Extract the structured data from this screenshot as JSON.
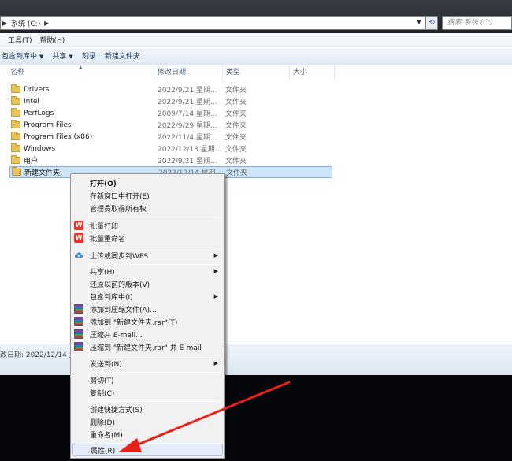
{
  "address_bar": {
    "crumbs": [
      "系统 (C:)"
    ],
    "search_placeholder": "搜索 系统 (C:)"
  },
  "menubar": {
    "items": [
      "工具(T)",
      "帮助(H)"
    ]
  },
  "toolbar": {
    "items": [
      "包含到库中",
      "共享",
      "刻录",
      "新建文件夹"
    ]
  },
  "columns": [
    "名称",
    "修改日期",
    "类型",
    "大小"
  ],
  "files": [
    {
      "name": "Drivers",
      "date": "2022/9/21 星期...",
      "type": "文件夹"
    },
    {
      "name": "Intel",
      "date": "2022/9/21 星期...",
      "type": "文件夹"
    },
    {
      "name": "PerfLogs",
      "date": "2009/7/14 星期...",
      "type": "文件夹"
    },
    {
      "name": "Program Files",
      "date": "2022/9/29 星期...",
      "type": "文件夹"
    },
    {
      "name": "Program Files (x86)",
      "date": "2022/11/4 星期...",
      "type": "文件夹"
    },
    {
      "name": "Windows",
      "date": "2022/12/13 星期...",
      "type": "文件夹"
    },
    {
      "name": "用户",
      "date": "2022/9/21 星期...",
      "type": "文件夹"
    },
    {
      "name": "新建文件夹",
      "date": "2022/12/14 星期...",
      "type": "文件夹"
    }
  ],
  "statusbar": {
    "text": "改日期: 2022/12/14 星"
  },
  "context_menu": {
    "items": [
      {
        "label": "打开(O)"
      },
      {
        "label": "在新窗口中打开(E)"
      },
      {
        "label": "管理员取得所有权"
      },
      {
        "label": "批量打印"
      },
      {
        "label": "批量重命名"
      },
      {
        "label": "上传或同步到WPS"
      },
      {
        "label": "共享(H)"
      },
      {
        "label": "还原以前的版本(V)"
      },
      {
        "label": "包含到库中(I)"
      },
      {
        "label": "添加到压缩文件(A)..."
      },
      {
        "label": "添加到 \"新建文件夹.rar\"(T)"
      },
      {
        "label": "压缩并 E-mail..."
      },
      {
        "label": "压缩到 \"新建文件夹.rar\" 并 E-mail"
      },
      {
        "label": "发送到(N)"
      },
      {
        "label": "剪切(T)"
      },
      {
        "label": "复制(C)"
      },
      {
        "label": "创建快捷方式(S)"
      },
      {
        "label": "删除(D)"
      },
      {
        "label": "重命名(M)"
      },
      {
        "label": "属性(R)"
      }
    ]
  },
  "colors": {
    "selection": "#cce4f7",
    "annotation_arrow": "#e8201c",
    "wps": "#e8352a"
  }
}
